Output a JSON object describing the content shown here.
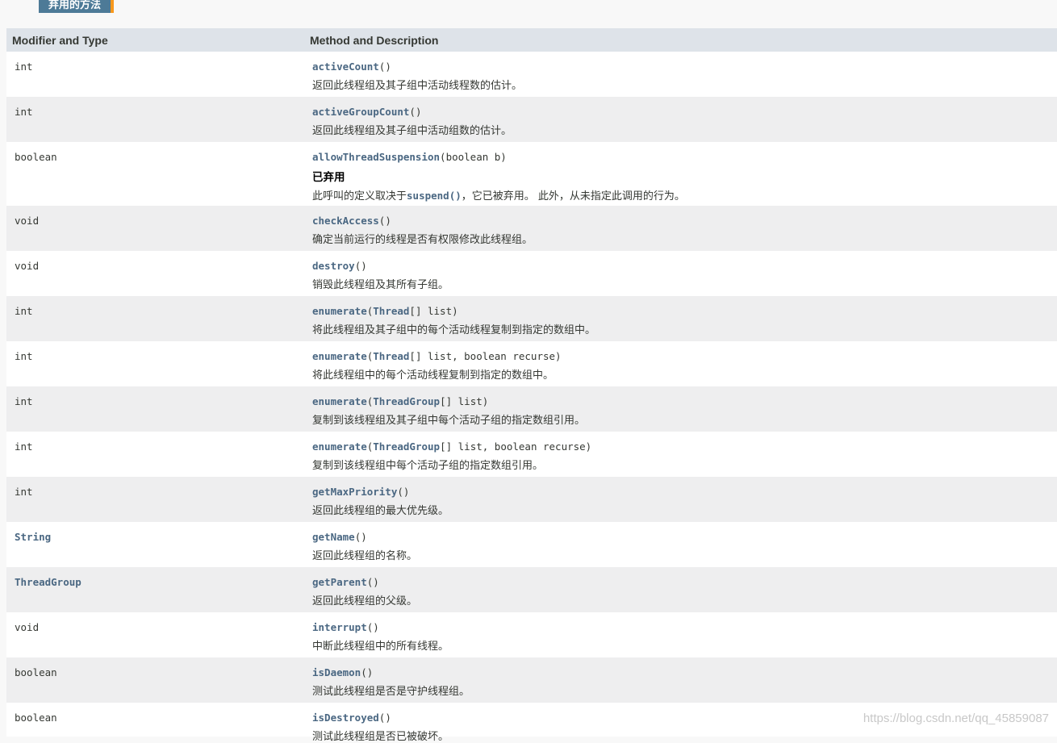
{
  "tab": {
    "label": "弃用的方法"
  },
  "table": {
    "col_type": "Modifier and Type",
    "col_method": "Method and Description"
  },
  "rows": [
    {
      "type": "int",
      "name": "activeCount",
      "params": "()",
      "desc": "返回此线程组及其子组中活动线程数的估计。"
    },
    {
      "type": "int",
      "name": "activeGroupCount",
      "params": "()",
      "desc": "返回此线程组及其子组中活动组数的估计。"
    },
    {
      "type": "boolean",
      "name": "allowThreadSuspension",
      "params": "(boolean b)",
      "deprecated": "已弃用",
      "desc_pre": "此呼叫的定义取决于",
      "desc_code": "suspend()",
      "desc_post": "，它已被弃用。 此外，从未指定此调用的行为。"
    },
    {
      "type": "void",
      "name": "checkAccess",
      "params": "()",
      "desc": "确定当前运行的线程是否有权限修改此线程组。"
    },
    {
      "type": "void",
      "name": "destroy",
      "params": "()",
      "desc": "销毁此线程组及其所有子组。"
    },
    {
      "type": "int",
      "name": "enumerate",
      "param_link": "Thread",
      "param_rest": "[] list)",
      "desc": "将此线程组及其子组中的每个活动线程复制到指定的数组中。"
    },
    {
      "type": "int",
      "name": "enumerate",
      "param_link": "Thread",
      "param_rest": "[] list, boolean recurse)",
      "desc": "将此线程组中的每个活动线程复制到指定的数组中。"
    },
    {
      "type": "int",
      "name": "enumerate",
      "param_link": "ThreadGroup",
      "param_rest": "[] list)",
      "desc": "复制到该线程组及其子组中每个活动子组的指定数组引用。"
    },
    {
      "type": "int",
      "name": "enumerate",
      "param_link": "ThreadGroup",
      "param_rest": "[] list, boolean recurse)",
      "desc": "复制到该线程组中每个活动子组的指定数组引用。"
    },
    {
      "type": "int",
      "name": "getMaxPriority",
      "params": "()",
      "desc": "返回此线程组的最大优先级。"
    },
    {
      "type": "String",
      "type_link": true,
      "name": "getName",
      "params": "()",
      "desc": "返回此线程组的名称。"
    },
    {
      "type": "ThreadGroup",
      "type_link": true,
      "name": "getParent",
      "params": "()",
      "desc": "返回此线程组的父级。"
    },
    {
      "type": "void",
      "name": "interrupt",
      "params": "()",
      "desc": "中断此线程组中的所有线程。"
    },
    {
      "type": "boolean",
      "name": "isDaemon",
      "params": "()",
      "desc": "测试此线程组是否是守护线程组。"
    },
    {
      "type": "boolean",
      "name": "isDestroyed",
      "params": "()",
      "desc": "测试此线程组是否已被破坏。"
    }
  ],
  "watermark": "https://blog.csdn.net/qq_45859087"
}
